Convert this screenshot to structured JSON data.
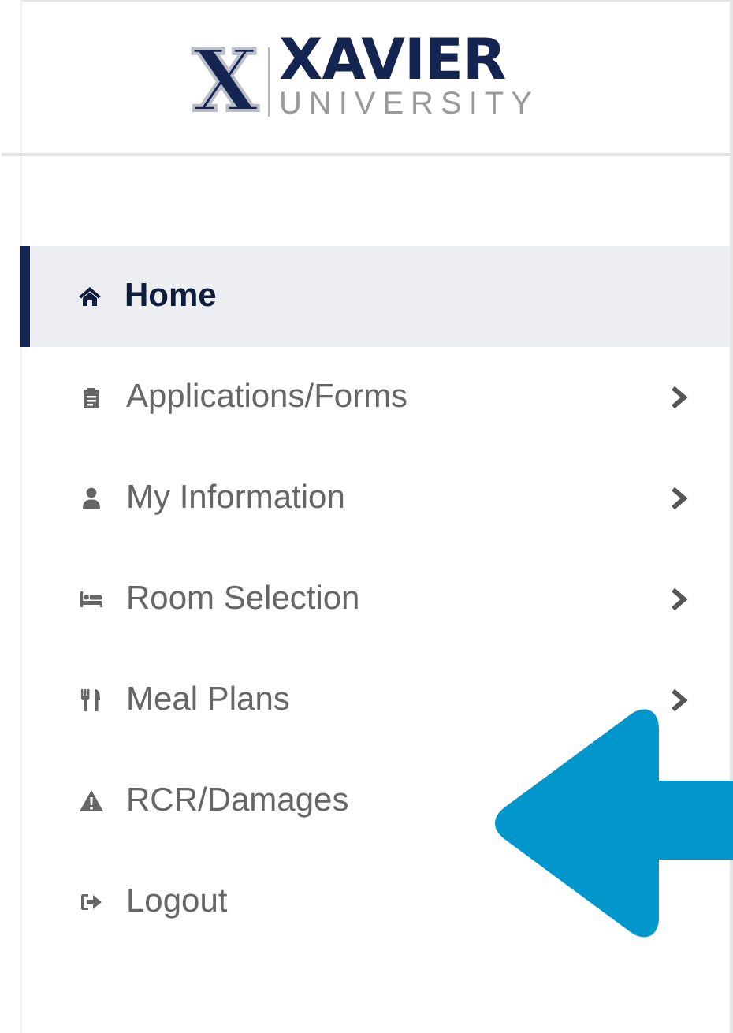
{
  "logo": {
    "mark": "X",
    "name": "XAVIER",
    "subtitle": "UNIVERSITY"
  },
  "menu": [
    {
      "label": "Home",
      "selected": true,
      "has_submenu": false
    },
    {
      "label": "Applications/Forms",
      "selected": false,
      "has_submenu": true
    },
    {
      "label": "My Information",
      "selected": false,
      "has_submenu": true
    },
    {
      "label": "Room Selection",
      "selected": false,
      "has_submenu": true
    },
    {
      "label": "Meal Plans",
      "selected": false,
      "has_submenu": true
    },
    {
      "label": "RCR/Damages",
      "selected": false,
      "has_submenu": false
    },
    {
      "label": "Logout",
      "selected": false,
      "has_submenu": false
    }
  ]
}
